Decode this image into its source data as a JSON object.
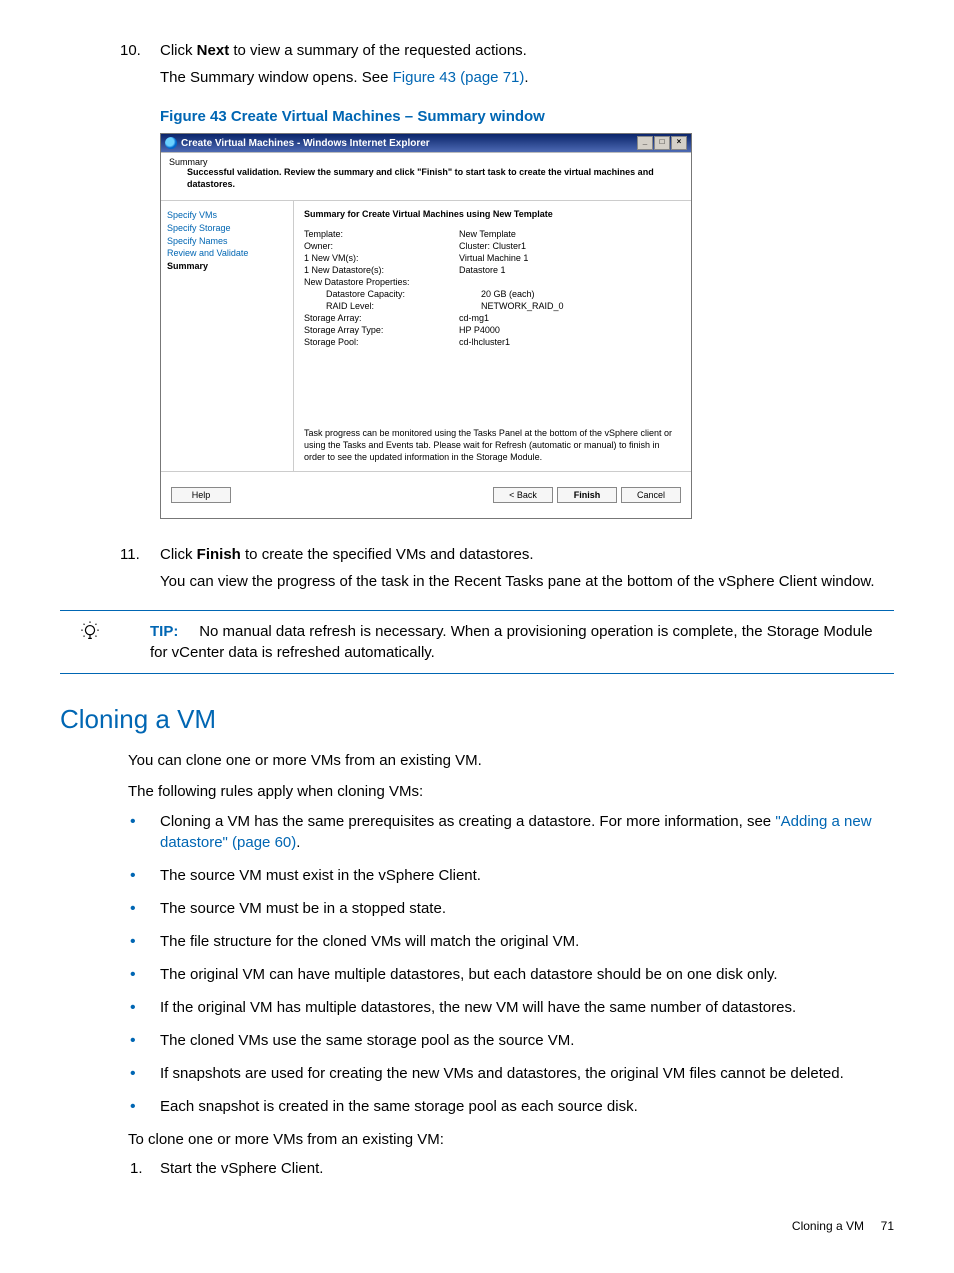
{
  "steps_top": {
    "num10": "10.",
    "line10a_1": "Click ",
    "line10a_bold": "Next",
    "line10a_2": " to view a summary of the requested actions.",
    "line10b_1": "The Summary window opens. See ",
    "line10b_link": "Figure 43 (page 71)",
    "line10b_2": ".",
    "num11": "11.",
    "line11a_1": "Click ",
    "line11a_bold": "Finish",
    "line11a_2": " to create the specified VMs and datastores.",
    "line11b": "You can view the progress of the task in the Recent Tasks pane at the bottom of the vSphere Client window."
  },
  "figure": {
    "caption": "Figure 43 Create Virtual Machines – Summary window",
    "window_title": "Create Virtual Machines - Windows Internet Explorer",
    "min_label": "_",
    "max_label": "□",
    "close_label": "×",
    "wiz_title": "Summary",
    "wiz_sub": "Successful validation. Review the summary and click \"Finish\" to start task to create the virtual machines and datastores.",
    "nav": {
      "a": "Specify VMs",
      "b": "Specify Storage",
      "c": "Specify Names",
      "d": "Review and Validate",
      "e": "Summary"
    },
    "content_title": "Summary for Create Virtual Machines using New Template",
    "rows": {
      "template_l": "Template:",
      "template_v": "New Template",
      "owner_l": "Owner:",
      "owner_v": "Cluster: Cluster1",
      "vm_l": "1 New VM(s):",
      "vm_v": "Virtual Machine 1",
      "ds_l": "1 New Datastore(s):",
      "ds_v": "Datastore 1",
      "dsprops_l": "New Datastore Properties:",
      "cap_l": "Datastore Capacity:",
      "cap_v": "20 GB (each)",
      "raid_l": "RAID Level:",
      "raid_v": "NETWORK_RAID_0",
      "arr_l": "Storage Array:",
      "arr_v": "cd-mg1",
      "arrtype_l": "Storage Array Type:",
      "arrtype_v": "HP P4000",
      "pool_l": "Storage Pool:",
      "pool_v": "cd-lhcluster1"
    },
    "footnote": "Task progress can be monitored using the Tasks Panel at the bottom of the vSphere client or using the Tasks and Events tab. Please wait for Refresh (automatic or manual) to finish in order to see the updated information in the Storage Module.",
    "btn_help": "Help",
    "btn_back": "< Back",
    "btn_finish": "Finish",
    "btn_cancel": "Cancel"
  },
  "tip": {
    "label": "TIP:",
    "text": "No manual data refresh is necessary. When a provisioning operation is complete, the Storage Module for vCenter data is refreshed automatically."
  },
  "clone_section": {
    "heading": "Cloning a VM",
    "intro1": "You can clone one or more VMs from an existing VM.",
    "intro2": "The following rules apply when cloning VMs:",
    "bullets": {
      "b1a": "Cloning a VM has the same prerequisites as creating a datastore. For more information, see ",
      "b1link": "\"Adding a new datastore\" (page 60)",
      "b1b": ".",
      "b2": "The source VM must exist in the vSphere Client.",
      "b3": "The source VM must be in a stopped state.",
      "b4": "The file structure for the cloned VMs will match the original VM.",
      "b5": "The original VM can have multiple datastores, but each datastore should be on one disk only.",
      "b6": "If the original VM has multiple datastores, the new VM will have the same number of datastores.",
      "b7": "The cloned VMs use the same storage pool as the source VM.",
      "b8": "If snapshots are used for creating the new VMs and datastores, the original VM files cannot be deleted.",
      "b9": "Each snapshot is created in the same storage pool as each source disk."
    },
    "outro": "To clone one or more VMs from an existing VM:",
    "step1_num": "1.",
    "step1_text": "Start the vSphere Client."
  },
  "footer": {
    "text": "Cloning a VM",
    "page": "71"
  }
}
